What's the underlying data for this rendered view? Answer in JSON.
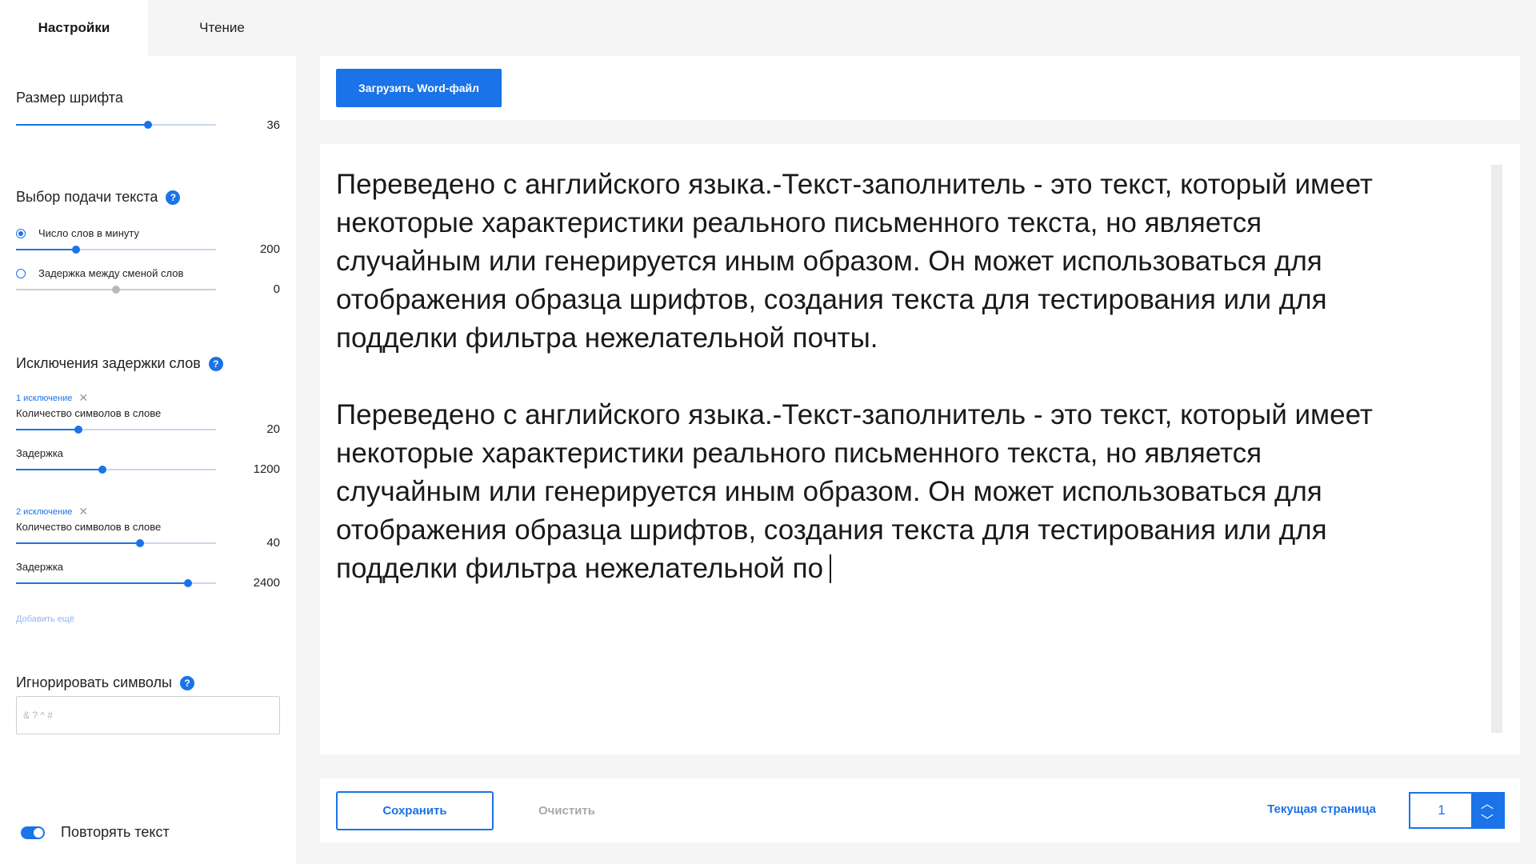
{
  "tabs": [
    {
      "label": "Настройки",
      "active": true
    },
    {
      "label": "Чтение",
      "active": false
    }
  ],
  "colors": {
    "accent": "#1a73e8",
    "background": "#f5f5f5",
    "panel": "#ffffff"
  },
  "font_size": {
    "title": "Размер шрифта",
    "value": "36",
    "level": 0.66
  },
  "delivery": {
    "title": "Выбор подачи текста",
    "help_icon": "question-icon",
    "help_glyph": "?",
    "options": [
      {
        "label": "Число слов в минуту",
        "value": "200",
        "selected": true,
        "level": 0.3
      },
      {
        "label": "Задержка между сменой слов",
        "value": "0",
        "selected": false,
        "level": 0.5
      }
    ]
  },
  "exceptions": {
    "title": "Исключения задержки слов",
    "help_glyph": "?",
    "remove_glyph": "✕",
    "items": [
      {
        "label": "1 исключение",
        "chars_label": "Количество символов в слове",
        "chars_value": "20",
        "chars_level": 0.31,
        "delay_label": "Задержка",
        "delay_value": "1200",
        "delay_level": 0.43
      },
      {
        "label": "2 исключение",
        "chars_label": "Количество символов в слове",
        "chars_value": "40",
        "chars_level": 0.62,
        "delay_label": "Задержка",
        "delay_value": "2400",
        "delay_level": 0.86
      }
    ],
    "add_more": "Добавить ещё"
  },
  "ignore": {
    "title": "Игнорировать символы",
    "help_glyph": "?",
    "placeholder": "& ? ^ #",
    "value": ""
  },
  "repeat": {
    "label": "Повторять текст",
    "on": true
  },
  "upload_button": "Загрузить Word-файл",
  "document_text": "Переведено с английского языка.-Текст-заполнитель - это текст, который имеет\nнекоторые характеристики реального письменного текста, но является\nслучайным или генерируется иным образом. Он может использоваться для\nотображения образца шрифтов, создания текста для тестирования или для\nподделки фильтра нежелательной почты.\n\nПереведено с английского языка.-Текст-заполнитель - это текст, который имеет\nнекоторые характеристики реального письменного текста, но является\nслучайным или генерируется иным образом. Он может использоваться для\nотображения образца шрифтов, создания текста для тестирования или для\nподделки фильтра нежелательной по",
  "footer": {
    "save": "Сохранить",
    "clear": "Очистить",
    "current_page_label": "Текущая страница",
    "current_page": "1",
    "up_glyph": "︿",
    "down_glyph": "﹀"
  }
}
